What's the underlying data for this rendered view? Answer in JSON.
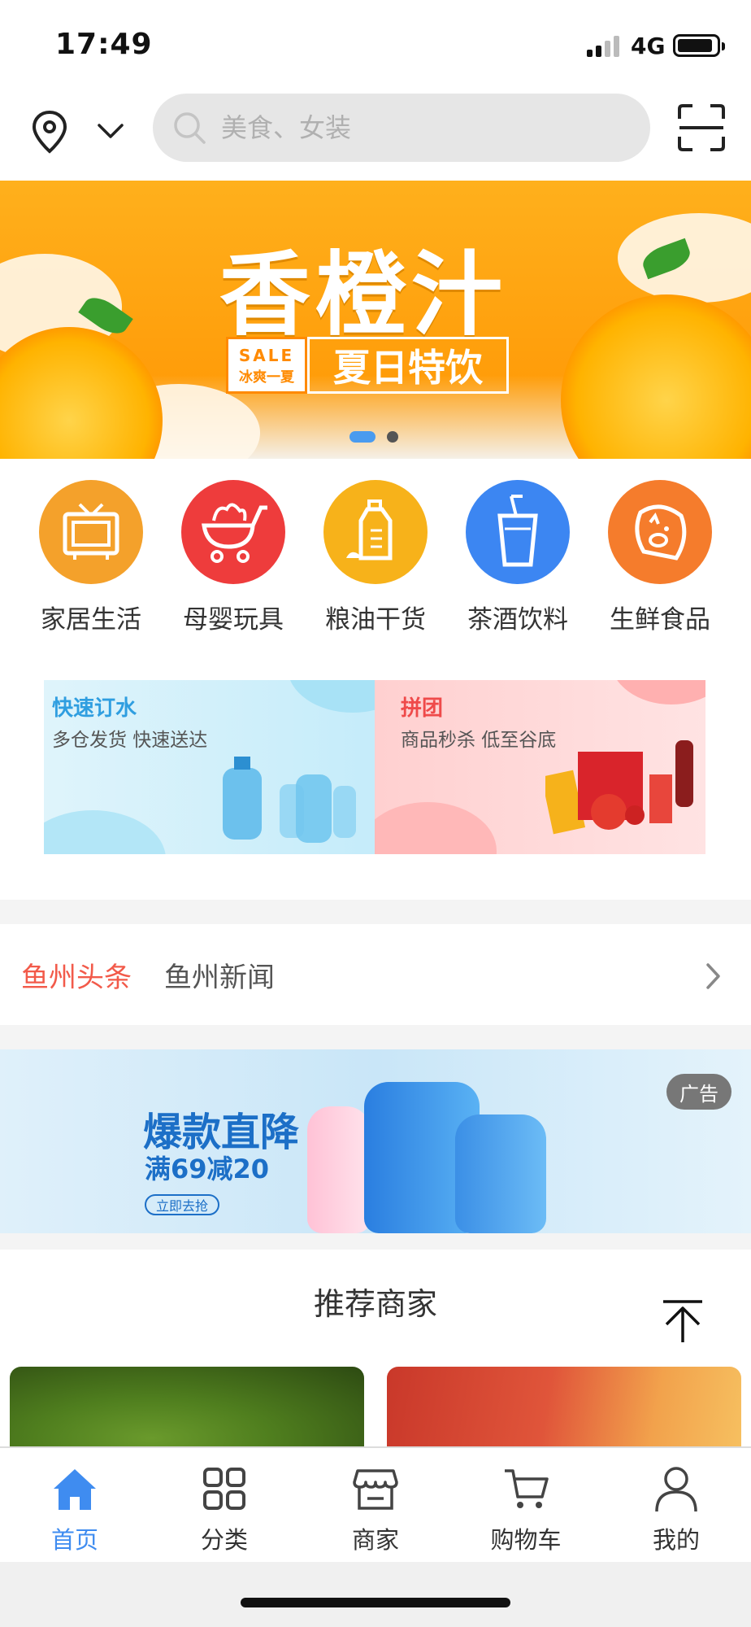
{
  "status_bar": {
    "time": "17:49",
    "network": "4G"
  },
  "header": {
    "search_placeholder": "美食、女装",
    "icons": {
      "location": "location-pin-icon",
      "dropdown": "chevron-down-icon",
      "search": "search-icon",
      "scan": "scan-icon"
    }
  },
  "banner": {
    "title": "香橙汁",
    "tag_en": "SALE",
    "tag_cn": "冰爽一夏",
    "tag_main": "夏日特饮",
    "slide_count": 2,
    "active_slide": 1
  },
  "categories": [
    {
      "label": "家居生活",
      "icon": "tv-icon",
      "color": "#f4a12b"
    },
    {
      "label": "母婴玩具",
      "icon": "stroller-icon",
      "color": "#ee3c3c"
    },
    {
      "label": "粮油干货",
      "icon": "oil-bottle-icon",
      "color": "#f7b21a"
    },
    {
      "label": "茶酒饮料",
      "icon": "drink-cup-icon",
      "color": "#3c86f2"
    },
    {
      "label": "生鲜食品",
      "icon": "pig-icon",
      "color": "#f57c2c"
    }
  ],
  "promos": [
    {
      "title": "快速订水",
      "subtitle": "多仓发货  快速送达",
      "title_color": "#2f9ee0"
    },
    {
      "title": "拼团",
      "subtitle": "商品秒杀  低至谷底",
      "title_color": "#ef4a4a"
    }
  ],
  "news": {
    "brand": "鱼州头条",
    "text": "鱼州新闻"
  },
  "ad": {
    "title": "爆款直降",
    "subtitle": "满69减20",
    "button": "立即去抢",
    "badge": "广告"
  },
  "recommend": {
    "title": "推荐商家"
  },
  "tabbar": [
    {
      "label": "首页",
      "icon": "home-icon",
      "active": true
    },
    {
      "label": "分类",
      "icon": "category-grid-icon",
      "active": false
    },
    {
      "label": "商家",
      "icon": "store-icon",
      "active": false
    },
    {
      "label": "购物车",
      "icon": "cart-icon",
      "active": false
    },
    {
      "label": "我的",
      "icon": "user-icon",
      "active": false
    }
  ],
  "colors": {
    "accent": "#3f8cf0",
    "news_brand": "#f25a4a",
    "banner_orange": "#ffa712"
  }
}
